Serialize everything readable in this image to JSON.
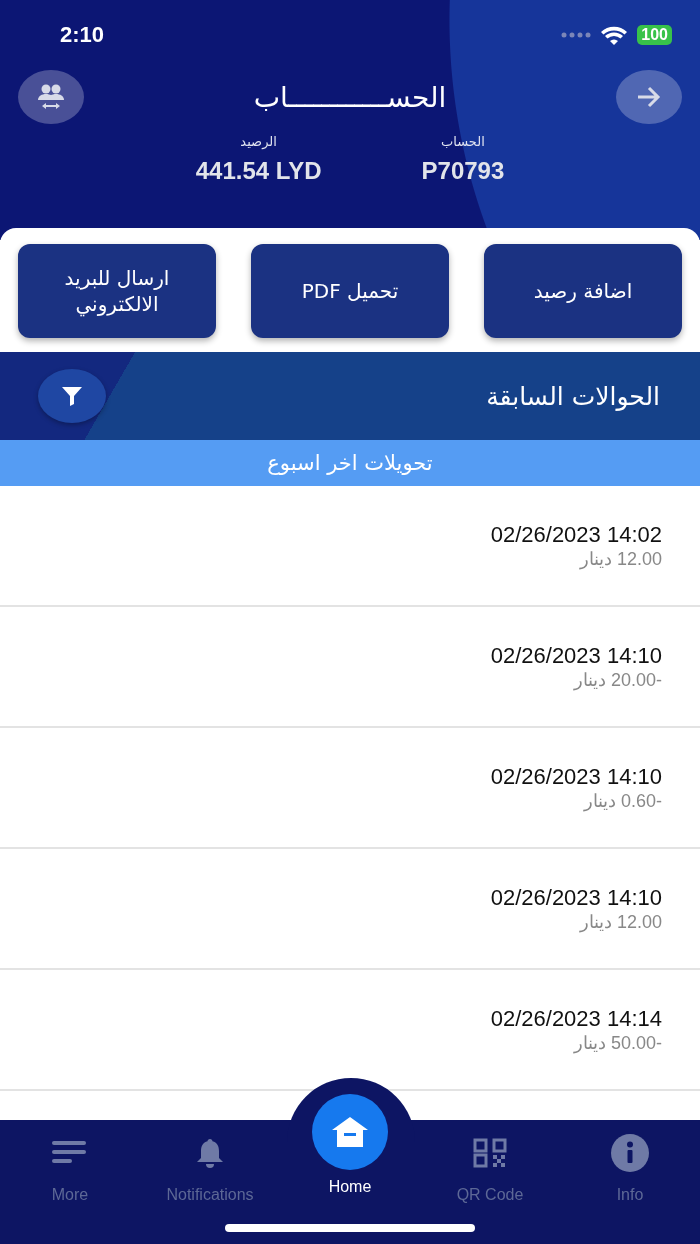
{
  "status_bar": {
    "time": "2:10",
    "battery": "100"
  },
  "header": {
    "title": "الحســــــــــــاب",
    "fields": [
      {
        "label": "الحساب",
        "value": "P70793"
      },
      {
        "label": "الرصيد",
        "value": "441.54 LYD"
      }
    ]
  },
  "actions": [
    "اضافة رصيد",
    "تحميل PDF",
    "ارسال للبريد الالكتروني"
  ],
  "section": {
    "title": "الحوالات السابقة",
    "subtitle": "تحويلات اخر اسبوع"
  },
  "transactions": [
    {
      "date": "02/26/2023 14:02",
      "amount": "12.00 دينار"
    },
    {
      "date": "02/26/2023 14:10",
      "amount": "-20.00 دينار"
    },
    {
      "date": "02/26/2023 14:10",
      "amount": "-0.60 دينار"
    },
    {
      "date": "02/26/2023 14:10",
      "amount": "12.00 دينار"
    },
    {
      "date": "02/26/2023 14:14",
      "amount": "-50.00 دينار"
    }
  ],
  "tab_bar": [
    {
      "kind": "info",
      "label": "Info",
      "selected": false
    },
    {
      "kind": "qr",
      "label": "QR Code",
      "selected": false
    },
    {
      "kind": "home",
      "label": "Home",
      "selected": true
    },
    {
      "kind": "bell",
      "label": "Notifications",
      "selected": false
    },
    {
      "kind": "more",
      "label": "More",
      "selected": false
    }
  ]
}
